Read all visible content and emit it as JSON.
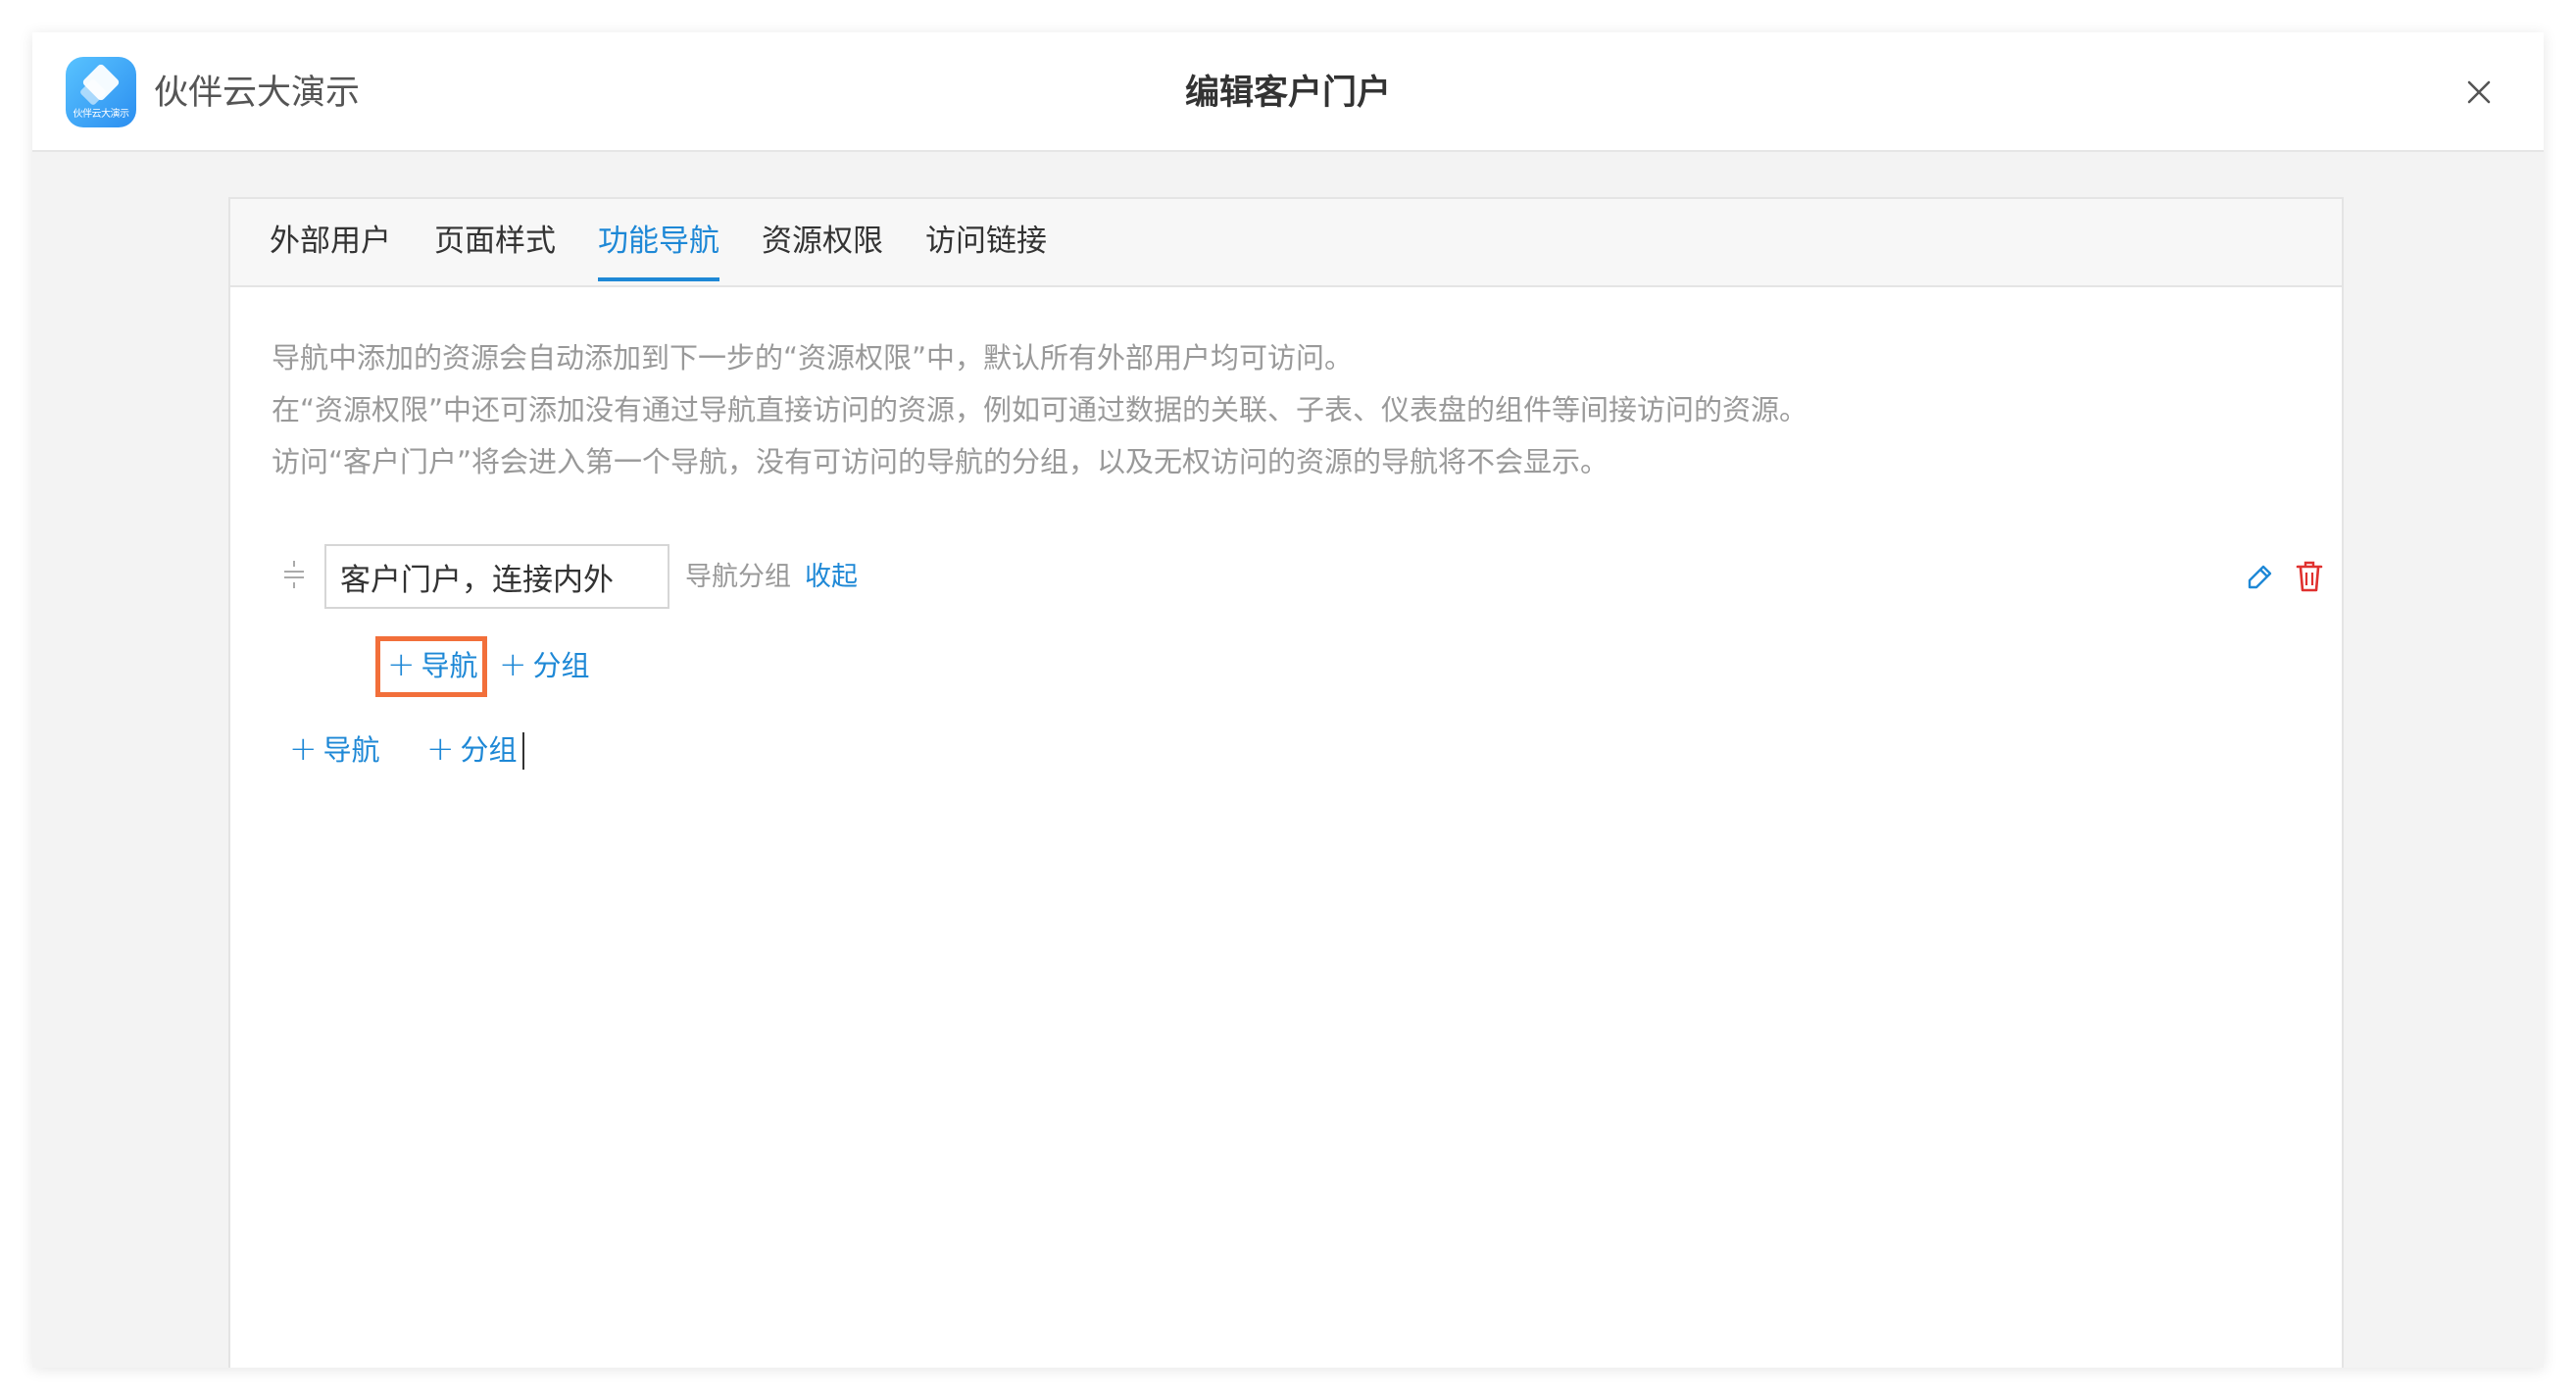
{
  "header": {
    "app_title": "伙伴云大演示",
    "logo_text": "伙伴云大演示",
    "dialog_title": "编辑客户门户"
  },
  "tabs": [
    {
      "label": "外部用户",
      "active": false
    },
    {
      "label": "页面样式",
      "active": false
    },
    {
      "label": "功能导航",
      "active": true
    },
    {
      "label": "资源权限",
      "active": false
    },
    {
      "label": "访问链接",
      "active": false
    }
  ],
  "description": [
    "导航中添加的资源会自动添加到下一步的“资源权限”中，默认所有外部用户均可访问。",
    "在“资源权限”中还可添加没有通过导航直接访问的资源，例如可通过数据的关联、子表、仪表盘的组件等间接访问的资源。",
    "访问“客户门户”将会进入第一个导航，没有可访问的导航的分组，以及无权访问的资源的导航将不会显示。"
  ],
  "nav_group": {
    "name_value": "客户门户，连接内外",
    "type_label": "导航分组",
    "collapse_label": "收起",
    "add_nav_label": "导航",
    "add_group_label": "分组"
  },
  "root_actions": {
    "add_nav_label": "导航",
    "add_group_label": "分组"
  },
  "symbols": {
    "plus": "+"
  },
  "colors": {
    "accent": "#1e88d6",
    "danger": "#e0312f",
    "highlight": "#f26f3a"
  },
  "icons": {
    "logo": "app-logo-icon",
    "close": "close-icon",
    "drag": "drag-handle-icon",
    "edit": "pencil-icon",
    "delete": "trash-icon"
  }
}
